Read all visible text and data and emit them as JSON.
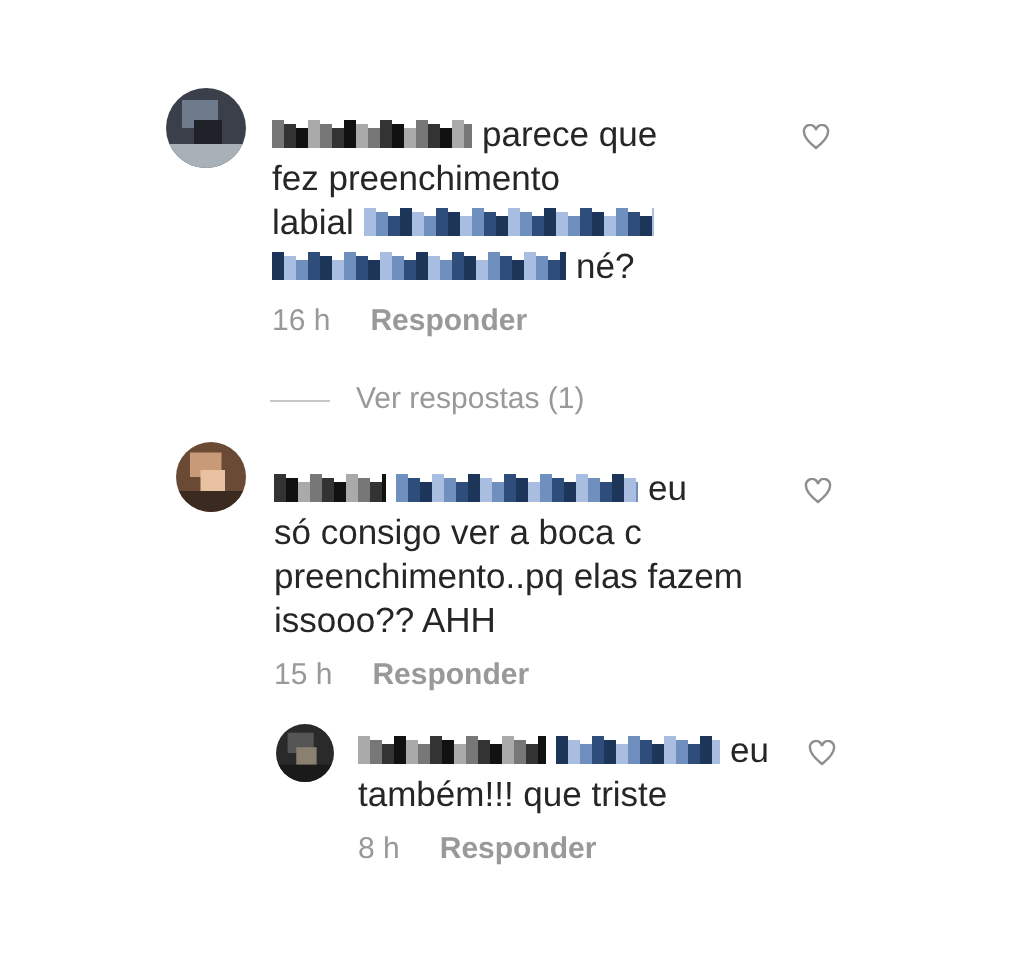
{
  "comments": [
    {
      "kind": "comment",
      "lines": [
        [
          {
            "kind": "username"
          },
          {
            "kind": "text",
            "text": "parece que"
          }
        ],
        [
          {
            "kind": "text",
            "text": "fez preenchimento"
          }
        ],
        [
          {
            "kind": "text",
            "text": "labial"
          },
          {
            "kind": "mention"
          }
        ],
        [
          {
            "kind": "mention"
          },
          {
            "kind": "text",
            "text": "né?"
          }
        ]
      ],
      "time": "16 h",
      "reply_label": "Responder",
      "liked": false
    },
    {
      "kind": "view_replies",
      "text": "Ver respostas (1)"
    },
    {
      "kind": "comment",
      "lines": [
        [
          {
            "kind": "username"
          },
          {
            "kind": "mention"
          },
          {
            "kind": "text",
            "text": "eu"
          }
        ],
        [
          {
            "kind": "text",
            "text": "só consigo ver a boca c"
          }
        ],
        [
          {
            "kind": "text",
            "text": "preenchimento..pq elas fazem"
          }
        ],
        [
          {
            "kind": "text",
            "text": "issooo?? AHH"
          }
        ]
      ],
      "time": "15 h",
      "reply_label": "Responder",
      "liked": false
    },
    {
      "kind": "reply",
      "lines": [
        [
          {
            "kind": "username"
          },
          {
            "kind": "mention"
          },
          {
            "kind": "text",
            "text": "eu"
          }
        ],
        [
          {
            "kind": "text",
            "text": "também!!! que triste"
          }
        ]
      ],
      "time": "8 h",
      "reply_label": "Responder",
      "liked": false
    }
  ]
}
